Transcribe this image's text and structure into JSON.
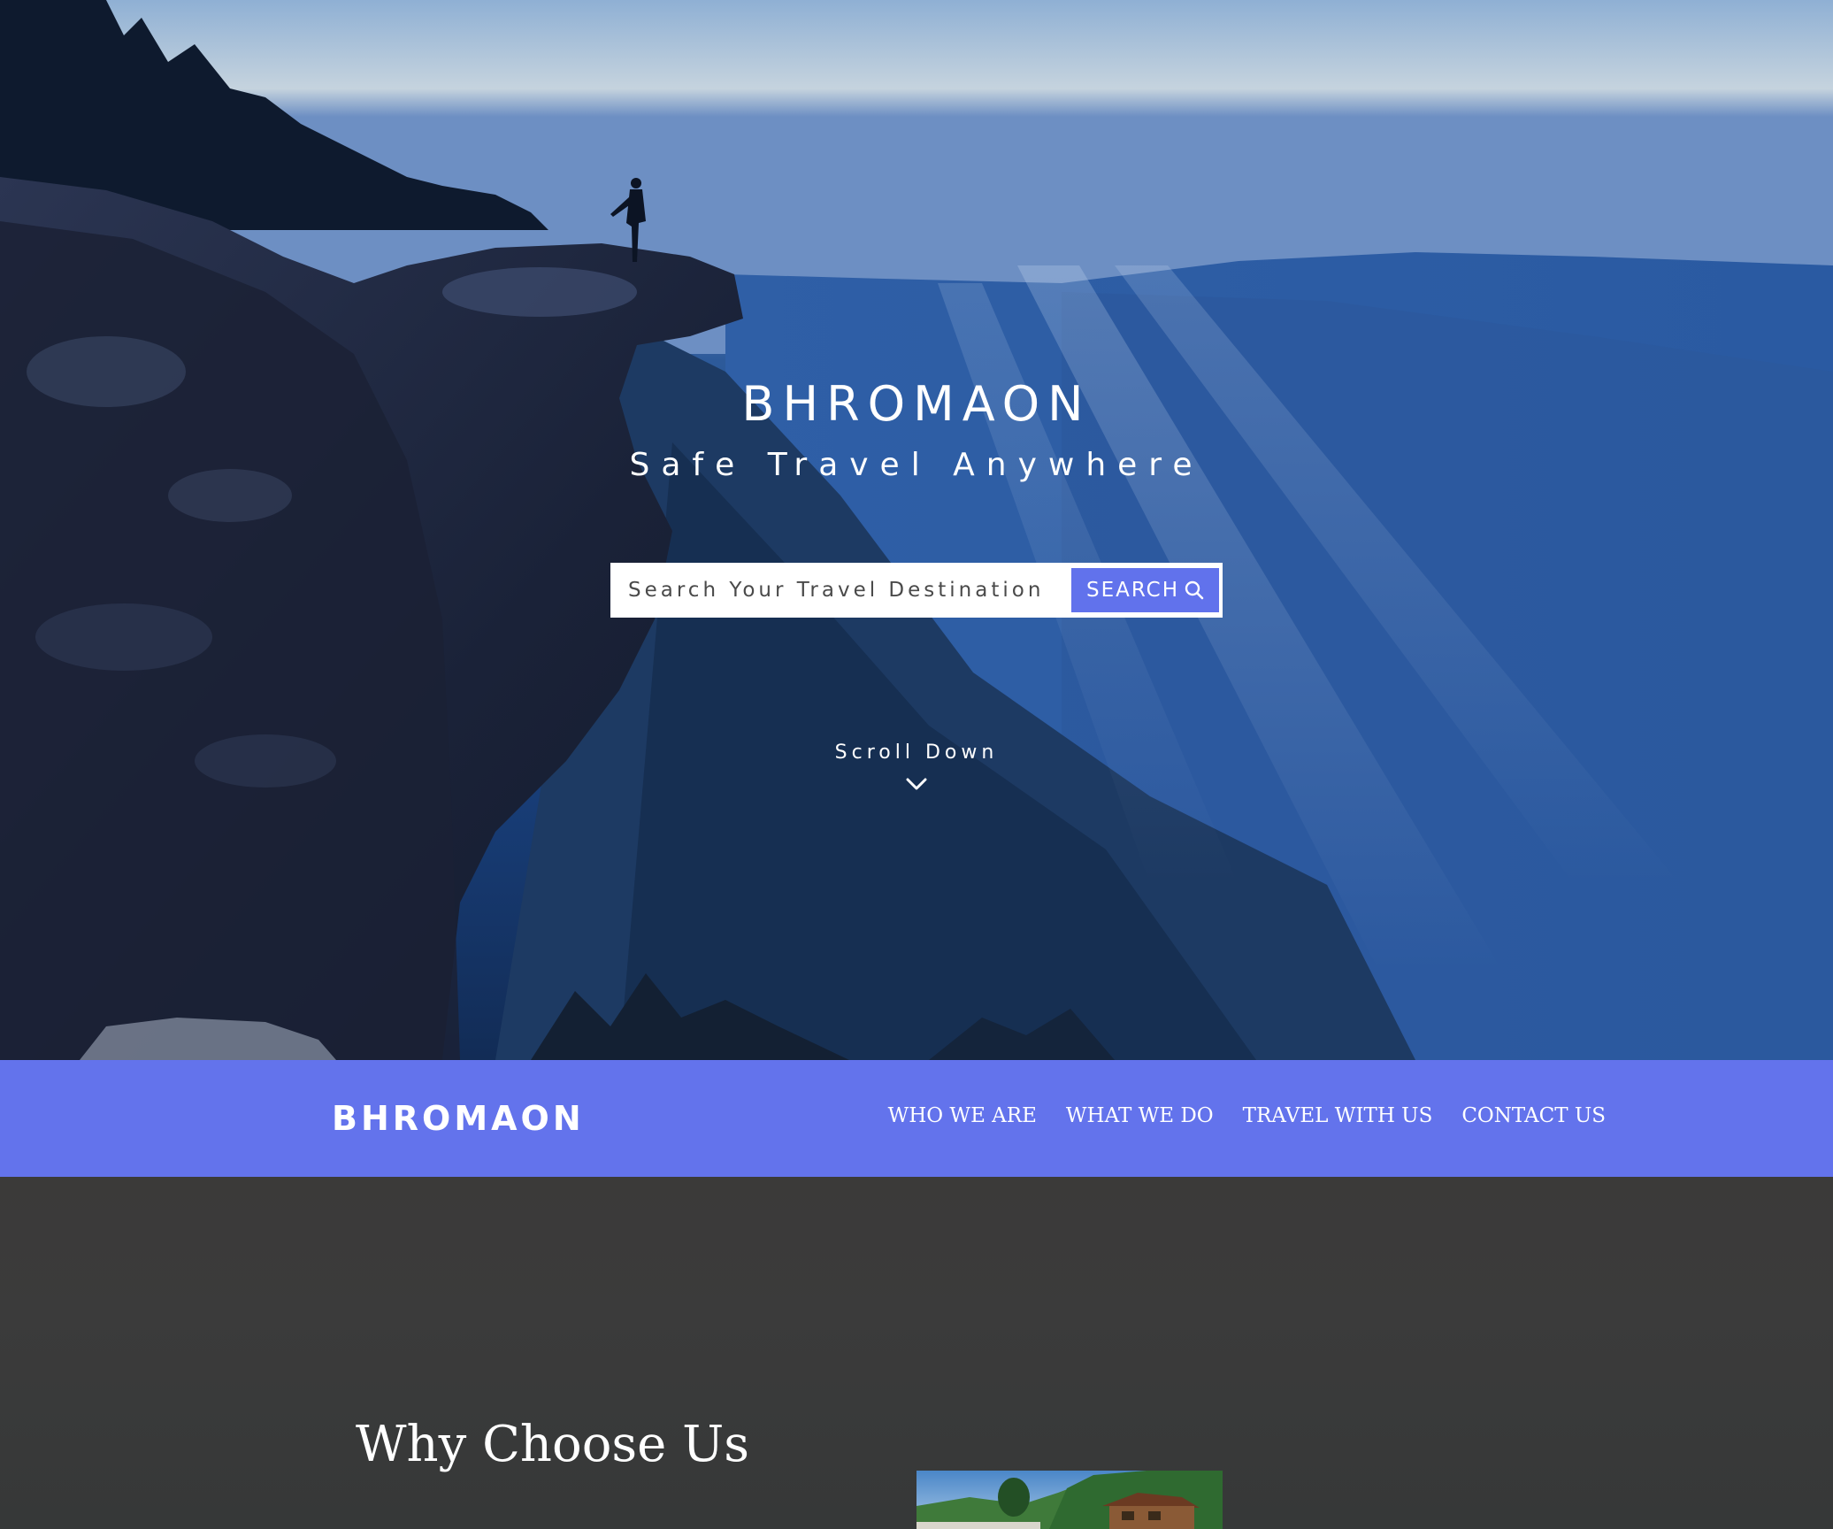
{
  "hero": {
    "title": "BHROMAON",
    "tagline": "Safe Travel Anywhere",
    "search": {
      "placeholder": "Search Your Travel Destination",
      "button_label": "SEARCH"
    },
    "scroll_label": "Scroll Down"
  },
  "navbar": {
    "brand": "BHROMAON",
    "links": [
      {
        "label": "WHO WE ARE"
      },
      {
        "label": "WHAT WE DO"
      },
      {
        "label": "TRAVEL WITH US"
      },
      {
        "label": "CONTACT US"
      }
    ]
  },
  "section": {
    "title": "Why Choose Us"
  },
  "colors": {
    "accent": "#6373ec",
    "section_bg": "#3a3a3a",
    "text_light": "#ffffff"
  },
  "icons": [
    "search-icon",
    "chevron-down-icon"
  ]
}
